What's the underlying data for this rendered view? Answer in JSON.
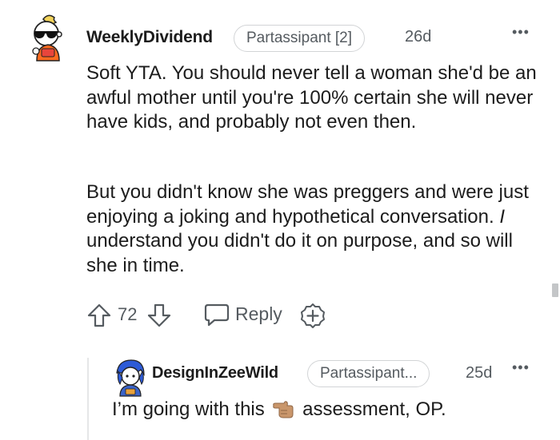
{
  "comment": {
    "author": "WeeklyDividend",
    "flair": "Partassipant [2]",
    "age": "26d",
    "more": "•••",
    "paragraph1": "Soft YTA. You should never tell a woman she'd be an awful mother until you're 100% certain she will never have kids, and probably not even then.",
    "paragraph2_before": "But you didn't know she was preggers and were just enjoying a joking and hypothetical conversation. ",
    "paragraph2_italic": "I",
    "paragraph2_after": " understand you didn't do it on purpose, and so will she in time.",
    "votes": "72",
    "reply_label": "Reply"
  },
  "reply": {
    "author": "DesignInZeeWild",
    "flair": "Partassipant...",
    "age": "25d",
    "more": "•••",
    "text_before": "I’m going with this ",
    "emoji": "point-left-emoji",
    "text_after": " assessment, OP."
  },
  "colors": {
    "text": "#1c1c1c",
    "meta": "#555b60",
    "flair_border": "#d2d4d6",
    "thread_line": "#e6e7e8"
  },
  "icons": [
    "upvote-icon",
    "downvote-icon",
    "reply-icon",
    "award-icon",
    "more-icon"
  ]
}
